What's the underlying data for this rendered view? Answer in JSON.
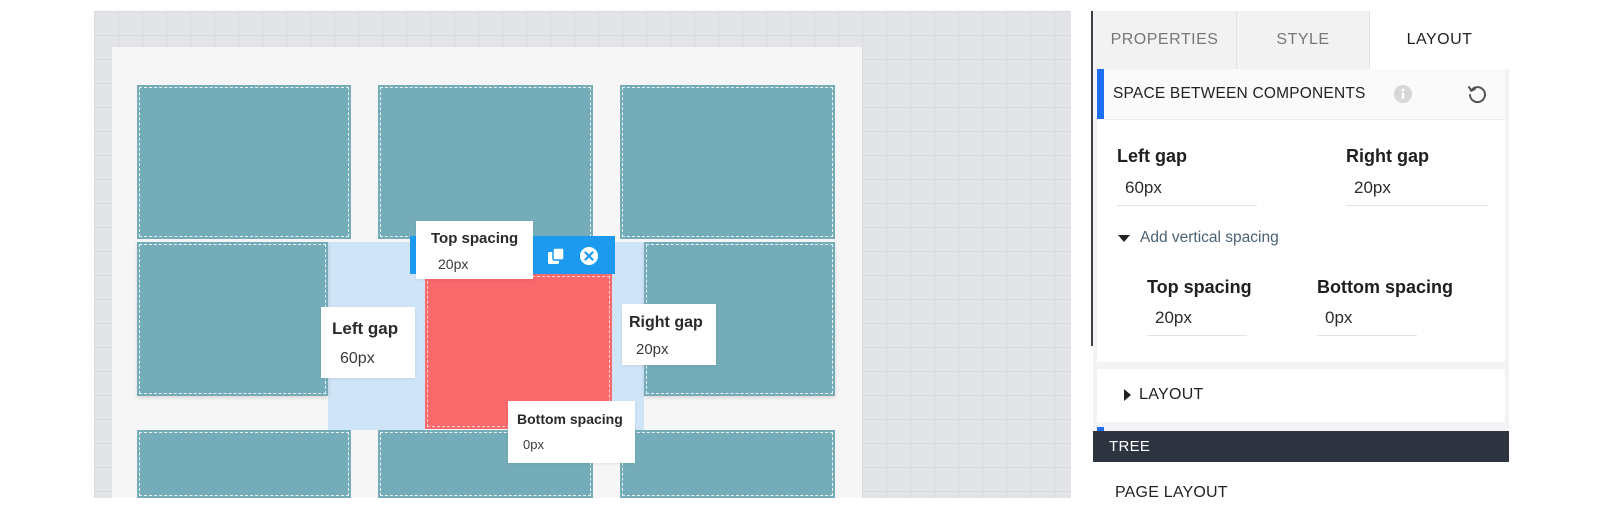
{
  "canvas": {
    "callouts": {
      "top_spacing": {
        "label": "Top spacing",
        "value": "20px"
      },
      "left_gap": {
        "label": "Left gap",
        "value": "60px"
      },
      "right_gap": {
        "label": "Right gap",
        "value": "20px"
      },
      "bottom_spacing": {
        "label": "Bottom spacing",
        "value": "0px"
      }
    },
    "colors": {
      "tile": "#74adb9",
      "selected": "#f9686b",
      "toolbar": "#1c9af0",
      "gap_highlight": "#cfe5f7"
    },
    "toolbar_icons": [
      "duplicate-icon",
      "remove-icon"
    ]
  },
  "panel": {
    "tabs": [
      {
        "label": "PROPERTIES",
        "active": false
      },
      {
        "label": "STYLE",
        "active": false
      },
      {
        "label": "LAYOUT",
        "active": true
      }
    ],
    "section": {
      "title": "SPACE BETWEEN COMPONENTS",
      "icons": [
        "info-icon",
        "reset-icon"
      ],
      "left_gap": {
        "label": "Left gap",
        "value": "60px"
      },
      "right_gap": {
        "label": "Right gap",
        "value": "20px"
      },
      "vertical_toggle": "Add vertical spacing",
      "top_spacing": {
        "label": "Top spacing",
        "value": "20px"
      },
      "bottom_spacing": {
        "label": "Bottom spacing",
        "value": "0px"
      }
    },
    "layout_section": {
      "label": "LAYOUT"
    },
    "tree": {
      "title": "TREE",
      "first_item": "PAGE LAYOUT"
    },
    "accent_color": "#1d6ef0"
  }
}
